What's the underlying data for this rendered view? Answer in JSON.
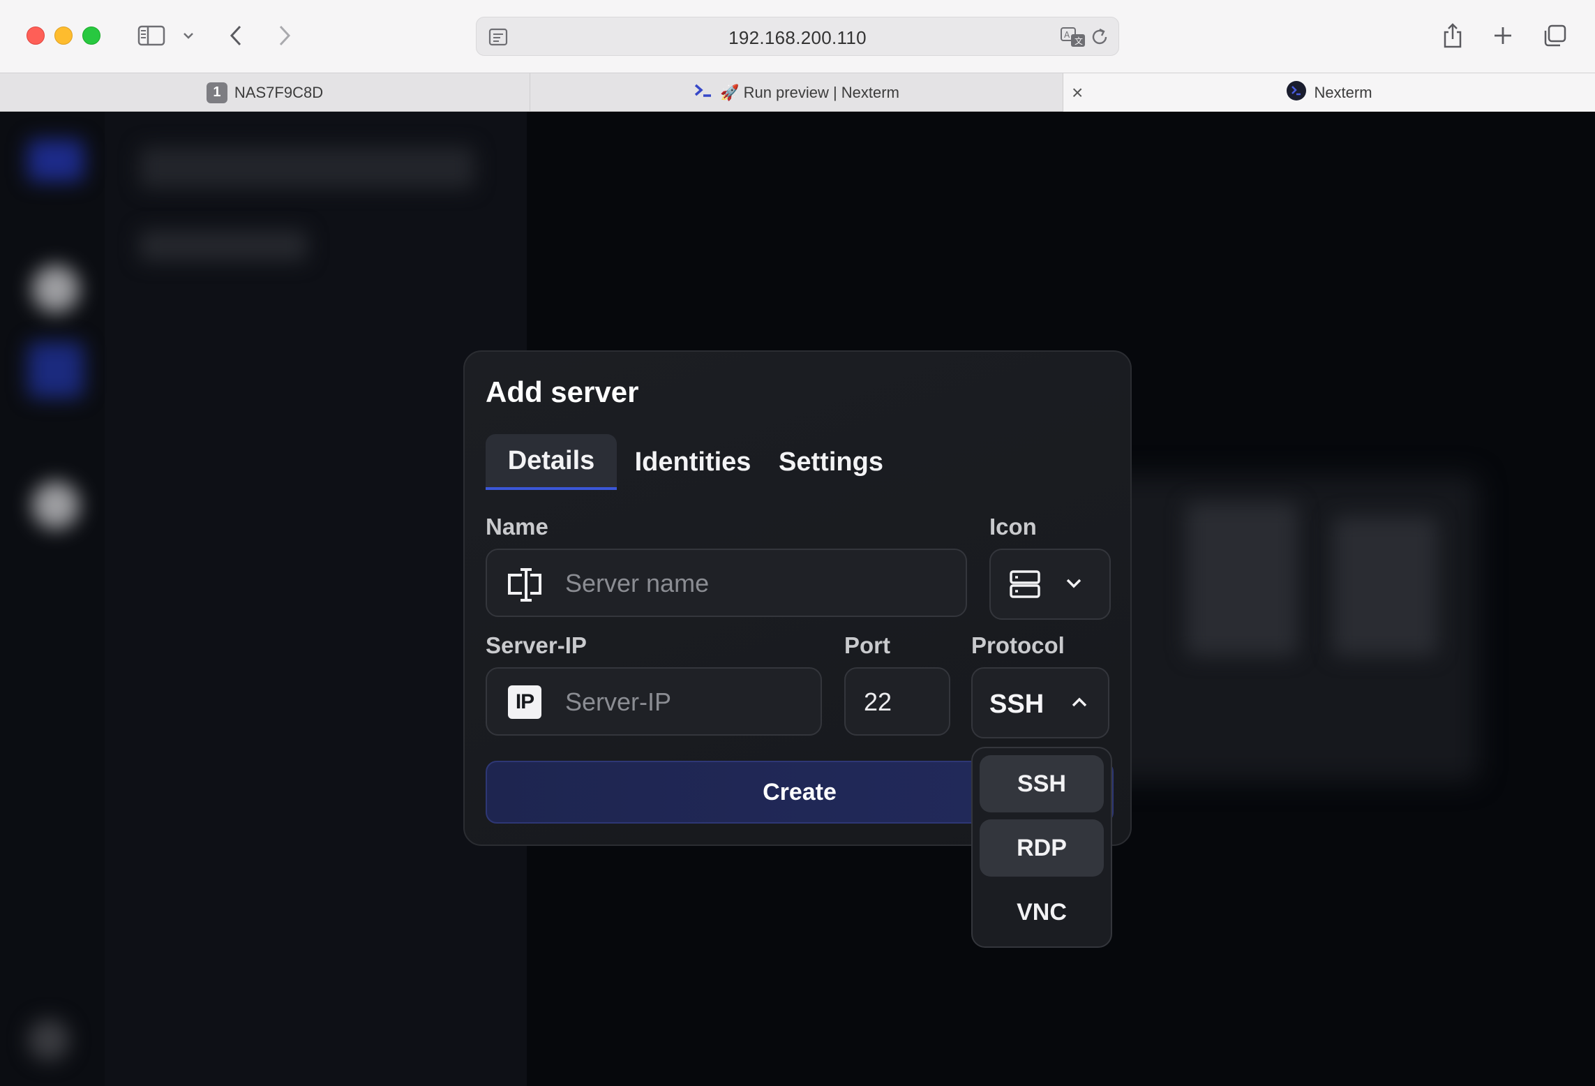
{
  "browser": {
    "url": "192.168.200.110",
    "tabs": [
      {
        "badge": "1",
        "title": "NAS7F9C8D"
      },
      {
        "title": "🚀 Run preview | Nexterm"
      },
      {
        "title": "Nexterm"
      }
    ]
  },
  "modal": {
    "title": "Add server",
    "tabs": [
      "Details",
      "Identities",
      "Settings"
    ],
    "active_tab": "Details",
    "fields": {
      "name_label": "Name",
      "name_placeholder": "Server name",
      "icon_label": "Icon",
      "ip_label": "Server-IP",
      "ip_placeholder": "Server-IP",
      "ip_badge": "IP",
      "port_label": "Port",
      "port_value": "22",
      "protocol_label": "Protocol",
      "protocol_value": "SSH"
    },
    "create_label": "Create"
  },
  "protocol_options": [
    "SSH",
    "RDP",
    "VNC"
  ],
  "colors": {
    "accent": "#3b57d8",
    "modal_bg": "#1c1e23",
    "create_bg": "#1e2550"
  },
  "icons": {
    "sidebar": "sidebar-icon",
    "back": "chevron-left-icon",
    "forward": "chevron-right-icon",
    "share": "share-icon",
    "new_tab": "plus-icon",
    "tab_overview": "tabs-overview-icon",
    "name_field": "text-cursor-icon",
    "icon_select": "server-icon",
    "protocol_chevron": "chevron-up-icon"
  }
}
